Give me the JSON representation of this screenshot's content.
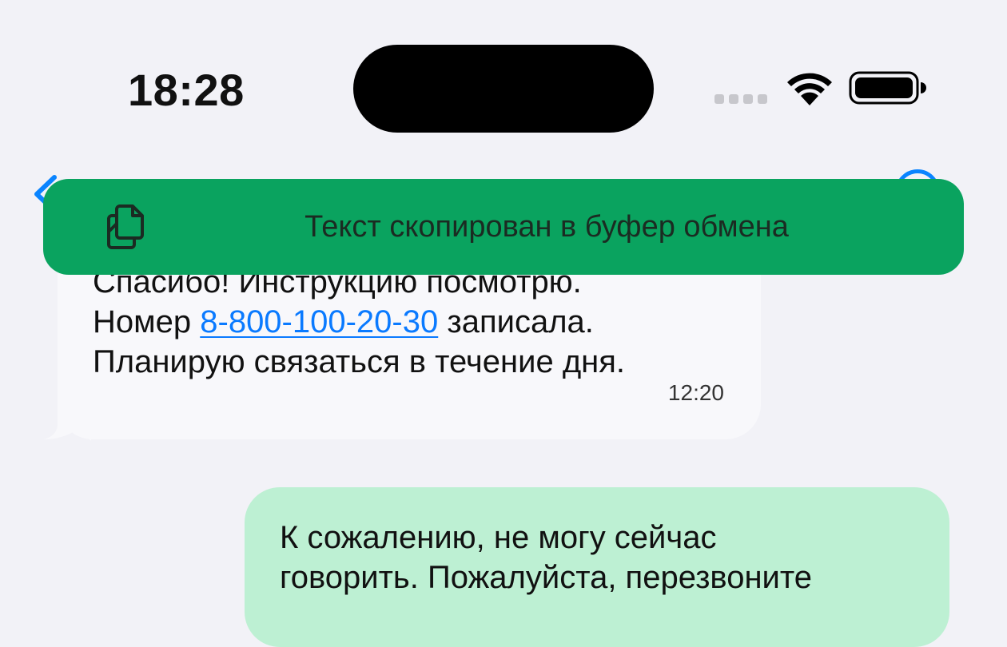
{
  "status_bar": {
    "time": "18:28"
  },
  "incoming_message": {
    "lines": [
      "Спасибо! Инструкцию посмотрю.",
      "Номер ",
      "8-800-100-20-30",
      " записала.",
      "Планирую связаться в течение дня."
    ],
    "time": "12:20"
  },
  "outgoing_message": {
    "lines": [
      "К сожалению, не могу сейчас",
      "говорить. Пожалуйста, перезвоните"
    ]
  },
  "toast": {
    "text": "Текст скопирован в буфер обмена",
    "icon": "copy-icon"
  },
  "colors": {
    "accent": "#0a84ff",
    "toast_bg": "#0aa35f",
    "outgoing_bubble": "#bdf0d3",
    "incoming_bubble": "#f8f8fb",
    "background": "#f2f2f7"
  }
}
